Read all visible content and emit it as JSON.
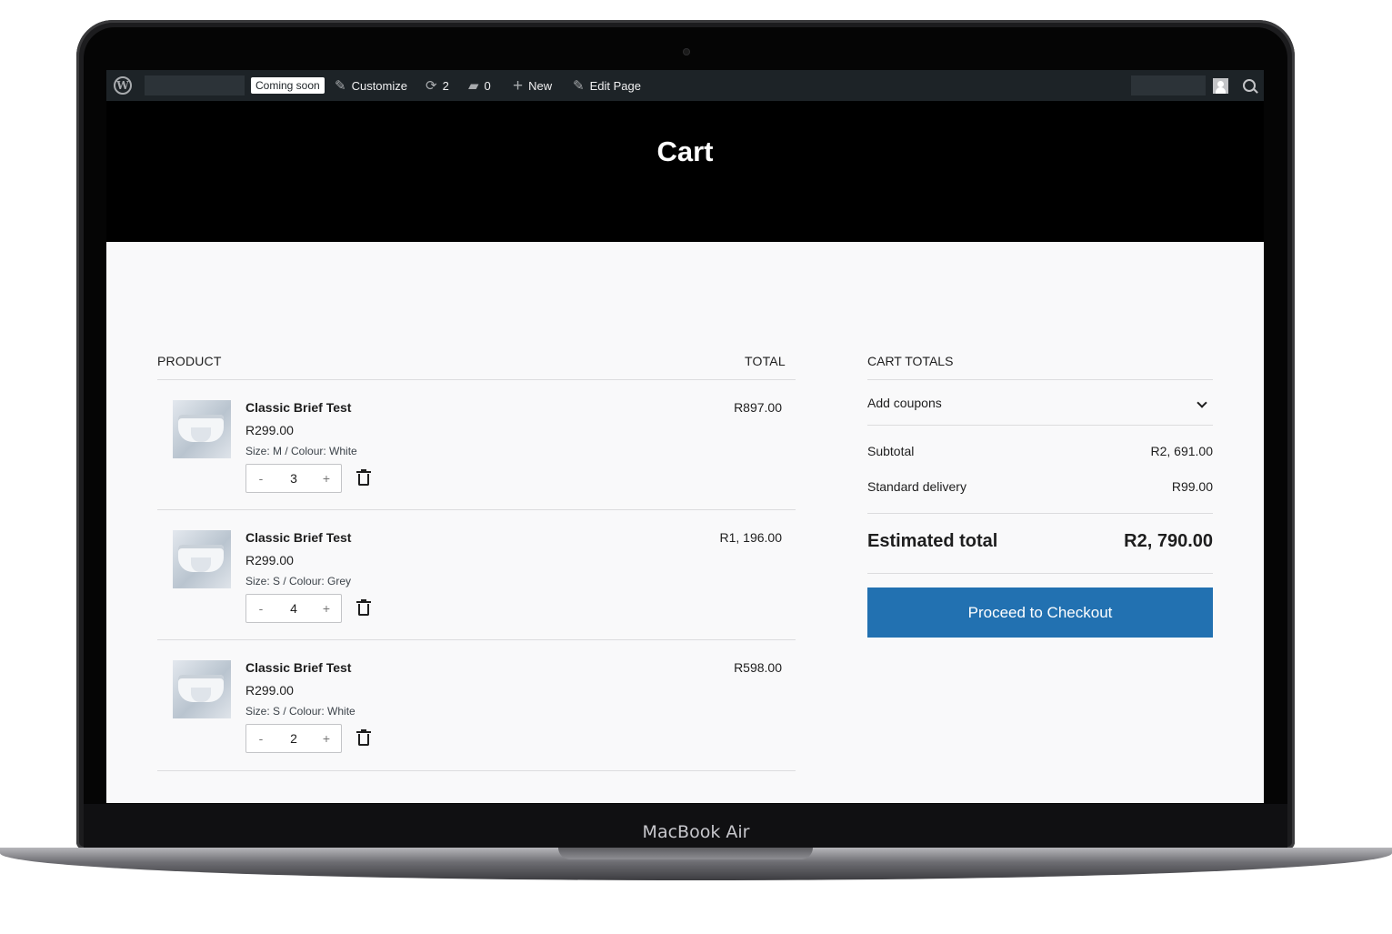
{
  "device": {
    "label": "MacBook Air"
  },
  "admin_bar": {
    "coming_soon": "Coming soon",
    "customize": "Customize",
    "updates_count": "2",
    "comments_count": "0",
    "new": "New",
    "edit_page": "Edit Page"
  },
  "page": {
    "title": "Cart"
  },
  "cart": {
    "header_product": "PRODUCT",
    "header_total": "TOTAL",
    "items": [
      {
        "name": "Classic Brief Test",
        "price": "R299.00",
        "meta": "Size: M / Colour: White",
        "qty": "3",
        "total": "R897.00"
      },
      {
        "name": "Classic Brief Test",
        "price": "R299.00",
        "meta": "Size: S / Colour: Grey",
        "qty": "4",
        "total": "R1, 196.00"
      },
      {
        "name": "Classic Brief Test",
        "price": "R299.00",
        "meta": "Size: S / Colour: White",
        "qty": "2",
        "total": "R598.00"
      }
    ],
    "qty_minus": "-",
    "qty_plus": "+"
  },
  "totals": {
    "heading": "CART TOTALS",
    "coupons": "Add coupons",
    "subtotal_label": "Subtotal",
    "subtotal_value": "R2, 691.00",
    "delivery_label": "Standard delivery",
    "delivery_value": "R99.00",
    "estimated_label": "Estimated total",
    "estimated_value": "R2, 790.00",
    "checkout": "Proceed to Checkout"
  },
  "colors": {
    "accent": "#2271b1",
    "admin_bar": "#1d2327",
    "header": "#000000"
  }
}
